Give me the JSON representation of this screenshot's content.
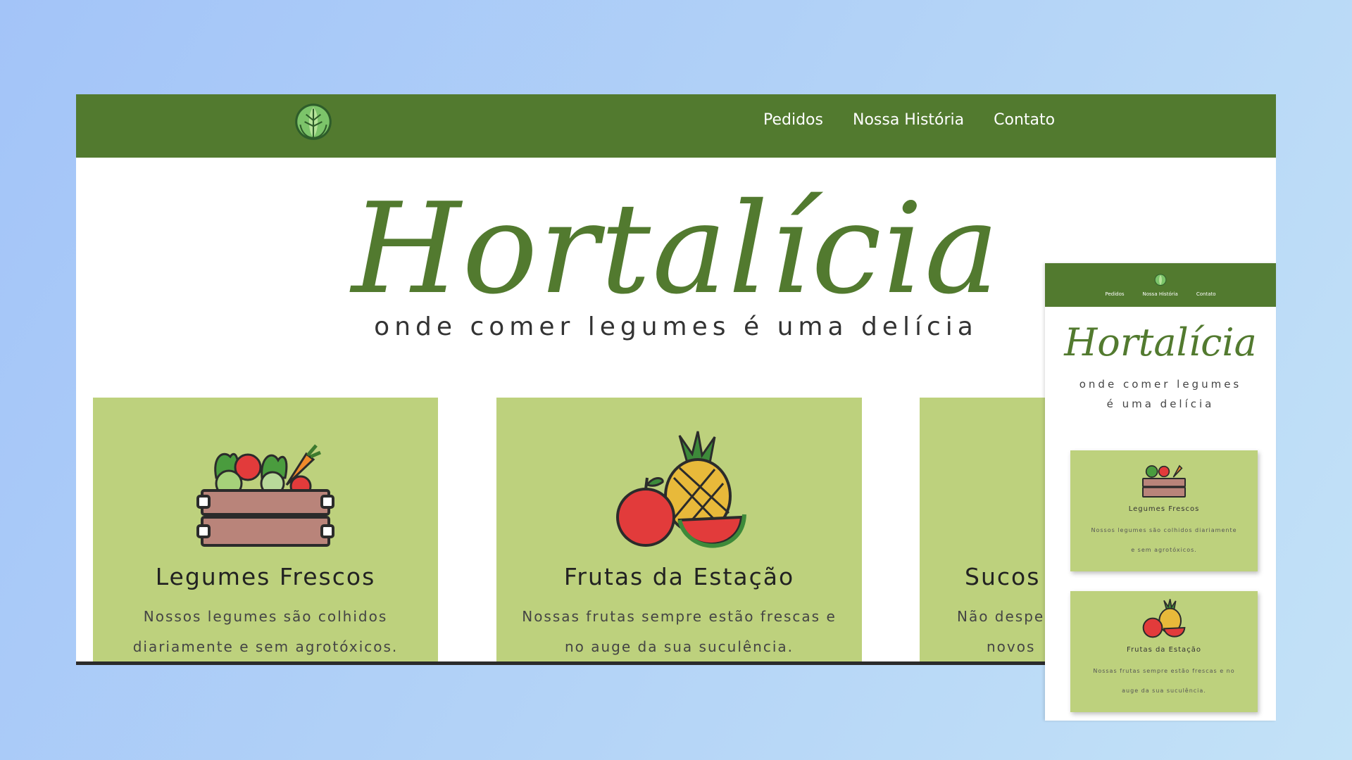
{
  "nav": {
    "logo_icon": "cabbage-icon",
    "links": [
      "Pedidos",
      "Nossa História",
      "Contato"
    ]
  },
  "hero": {
    "title": "Hortalícia",
    "tagline": "onde comer legumes é uma delícia"
  },
  "cards": [
    {
      "icon": "vegetable-crate-icon",
      "title": "Legumes Frescos",
      "text_line1": "Nossos legumes são colhidos",
      "text_line2": "diariamente e sem agrotóxicos."
    },
    {
      "icon": "pineapple-apple-watermelon-icon",
      "title": "Frutas da Estação",
      "text_line1": "Nossas frutas sempre estão frescas e",
      "text_line2": "no auge da sua suculência."
    },
    {
      "icon": "juice-icon",
      "title": "Sucos",
      "text_line1": "Não desper",
      "text_line2": "novos"
    }
  ],
  "mobile": {
    "title": "Hortalícia",
    "links": [
      "Pedidos",
      "Nossa História",
      "Contato"
    ],
    "tagline_line1": "onde comer legumes",
    "tagline_line2": "é uma delícia",
    "cards": [
      {
        "title": "Legumes Frescos",
        "text_line1": "Nossos legumes são colhidos diariamente",
        "text_line2": "e sem agrotóxicos."
      },
      {
        "title": "Frutas da Estação",
        "text_line1": "Nossas frutas sempre estão frescas e no",
        "text_line2": "auge da sua suculência."
      }
    ]
  },
  "colors": {
    "background_gradient_start": "#a3c4f8",
    "background_gradient_end": "#c3e2f7",
    "nav_green": "#527a2f",
    "card_green": "#bdd17d",
    "title_green": "#527a2f"
  }
}
